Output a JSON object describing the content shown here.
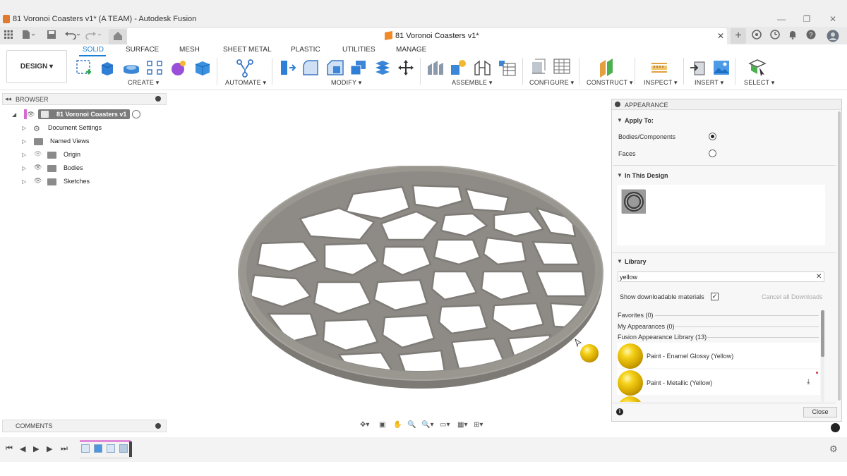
{
  "window": {
    "title": "81 Voronoi Coasters v1* (A TEAM) - Autodesk Fusion",
    "minimize": "—",
    "restore": "❐",
    "close": "✕"
  },
  "document_tab": {
    "title": "81 Voronoi Coasters v1*",
    "close": "✕"
  },
  "toolbar": {
    "workspace": "DESIGN ▾",
    "tabs": [
      "SOLID",
      "SURFACE",
      "MESH",
      "SHEET METAL",
      "PLASTIC",
      "UTILITIES",
      "MANAGE"
    ],
    "active_tab": "SOLID",
    "groups": [
      "CREATE ▾",
      "AUTOMATE ▾",
      "MODIFY ▾",
      "ASSEMBLE ▾",
      "CONFIGURE ▾",
      "CONSTRUCT ▾",
      "INSPECT ▾",
      "INSERT ▾",
      "SELECT ▾"
    ]
  },
  "browser": {
    "title": "BROWSER",
    "root": "81 Voronoi Coasters v1",
    "items": [
      "Document Settings",
      "Named Views",
      "Origin",
      "Bodies",
      "Sketches"
    ]
  },
  "comments": {
    "title": "COMMENTS"
  },
  "appearance": {
    "title": "APPEARANCE",
    "apply_to": {
      "heading": "Apply To:",
      "options": [
        "Bodies/Components",
        "Faces"
      ],
      "selected": "Bodies/Components"
    },
    "in_this_design": "In This Design",
    "library": {
      "heading": "Library",
      "search_value": "yellow",
      "show_downloadable": "Show downloadable materials",
      "show_downloadable_checked": true,
      "cancel_downloads": "Cancel all Downloads",
      "categories": [
        "Favorites (0)",
        "My Appearances (0)",
        "Fusion Appearance Library (13)"
      ],
      "materials": [
        "Paint - Enamel Glossy (Yellow)",
        "Paint - Metallic (Yellow)"
      ]
    },
    "close_button": "Close",
    "info_icon": "i"
  },
  "colors": {
    "accent": "#1a7ed3",
    "model": "#8e8b86",
    "timeline_marker": "#e18ad9"
  },
  "icons": [
    "grid-icon",
    "file-icon",
    "save-icon",
    "undo-icon",
    "redo-icon",
    "home-icon",
    "plus-icon",
    "online-icon",
    "clock-icon",
    "bell-icon",
    "help-icon",
    "profile-icon",
    "gear-icon",
    "download-icon"
  ]
}
